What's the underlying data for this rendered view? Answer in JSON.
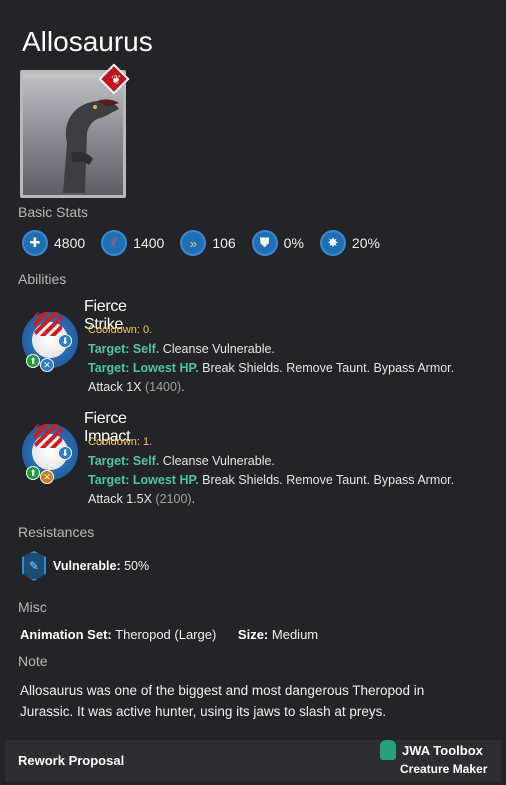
{
  "creature": {
    "name": "Allosaurus",
    "rarity_icon": "claw-icon"
  },
  "sections": {
    "basic_stats": "Basic Stats",
    "abilities": "Abilities",
    "resistances": "Resistances",
    "misc": "Misc",
    "note": "Note"
  },
  "stats": [
    {
      "icon": "health-icon",
      "glyph": "✚",
      "value": "4800"
    },
    {
      "icon": "damage-icon",
      "glyph": "////",
      "value": "1400"
    },
    {
      "icon": "speed-icon",
      "glyph": "»",
      "value": "106"
    },
    {
      "icon": "armor-icon",
      "glyph": "⛊",
      "value": "0%"
    },
    {
      "icon": "crit-icon",
      "glyph": "✸",
      "value": "20%"
    }
  ],
  "abilities": [
    {
      "name": "Fierce Strike",
      "cooldown": "Cooldown: 0.",
      "line1_target": "Target: Self.",
      "line1_text": "Cleanse Vulnerable.",
      "line2_target": "Target: Lowest HP.",
      "line2_text": "Break Shields. Remove Taunt. Bypass Armor.",
      "attack_prefix": "Attack 1X",
      "attack_value": "(1400)",
      "attack_suffix": "."
    },
    {
      "name": "Fierce Impact",
      "cooldown": "Cooldown: 1.",
      "line1_target": "Target: Self.",
      "line1_text": "Cleanse Vulnerable.",
      "line2_target": "Target: Lowest HP.",
      "line2_text": "Break Shields. Remove Taunt. Bypass Armor.",
      "attack_prefix": "Attack 1.5X",
      "attack_value": "(2100)",
      "attack_suffix": "."
    }
  ],
  "resistance": {
    "icon": "vulnerable-resist-icon",
    "label": "Vulnerable:",
    "value": "50%"
  },
  "misc": {
    "animation_label": "Animation Set:",
    "animation_value": "Theropod (Large)",
    "size_label": "Size:",
    "size_value": "Medium"
  },
  "note_text": "Allosaurus was one of the biggest and most dangerous Theropod in Jurassic. It was active hunter, using its jaws to slash at preys.",
  "footer": {
    "title": "Rework Proposal",
    "brand": "JWA Toolbox",
    "sub": "Creature Maker"
  },
  "colors": {
    "background": "#232427",
    "cooldown": "#f2c94c",
    "target": "#4ac7a0",
    "stat_icon": "#1f6fb6",
    "rarity": "#c1121f"
  }
}
